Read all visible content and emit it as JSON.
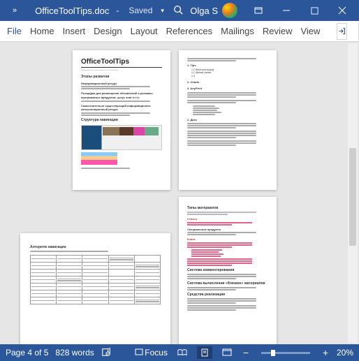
{
  "titlebar": {
    "docname": "OfficeToolTips.doc",
    "saved_label": "Saved",
    "separator": "-",
    "user": "Olga S"
  },
  "ribbon": {
    "tabs": [
      "File",
      "Home",
      "Insert",
      "Design",
      "Layout",
      "References",
      "Mailings",
      "Review",
      "View"
    ]
  },
  "pages": {
    "p1": {
      "title": "OfficeToolTips",
      "subtitle": "Информационный ресурс о возможностях Microsoft Office",
      "sec1": "Этапы развития",
      "sec2": "Информационный ресурс",
      "sec3": "Площадка для размещения объявлений и рекламы программных продуктов, услуг, книг и т.п.",
      "sec4": "Самостоятельно существующий информационно-консультационный ресурс",
      "sec5": "Структура навигации"
    },
    "p2": {
      "sec1": "1. Tips",
      "item1": "1.1 Word processing",
      "item2": "1.2 Spread sheets",
      "item3": "1.3",
      "sec2": "2. Charts",
      "sec3": "3. AnyPrint"
    },
    "p3": {
      "sec1": "Алгоритм навигации"
    },
    "p4": {
      "sec1": "Типы материалов",
      "sec2": "Статьи",
      "sec3": "Специальные продукты",
      "sec4": "Книги",
      "sec5": "Система комментирования",
      "sec6": "Система вычисления «близких» материалов",
      "sec7": "Средства реализации"
    }
  },
  "statusbar": {
    "page_status": "Page 4 of 5",
    "word_count": "828 words",
    "focus_mode": "Focus",
    "zoom_percent": "20%"
  }
}
